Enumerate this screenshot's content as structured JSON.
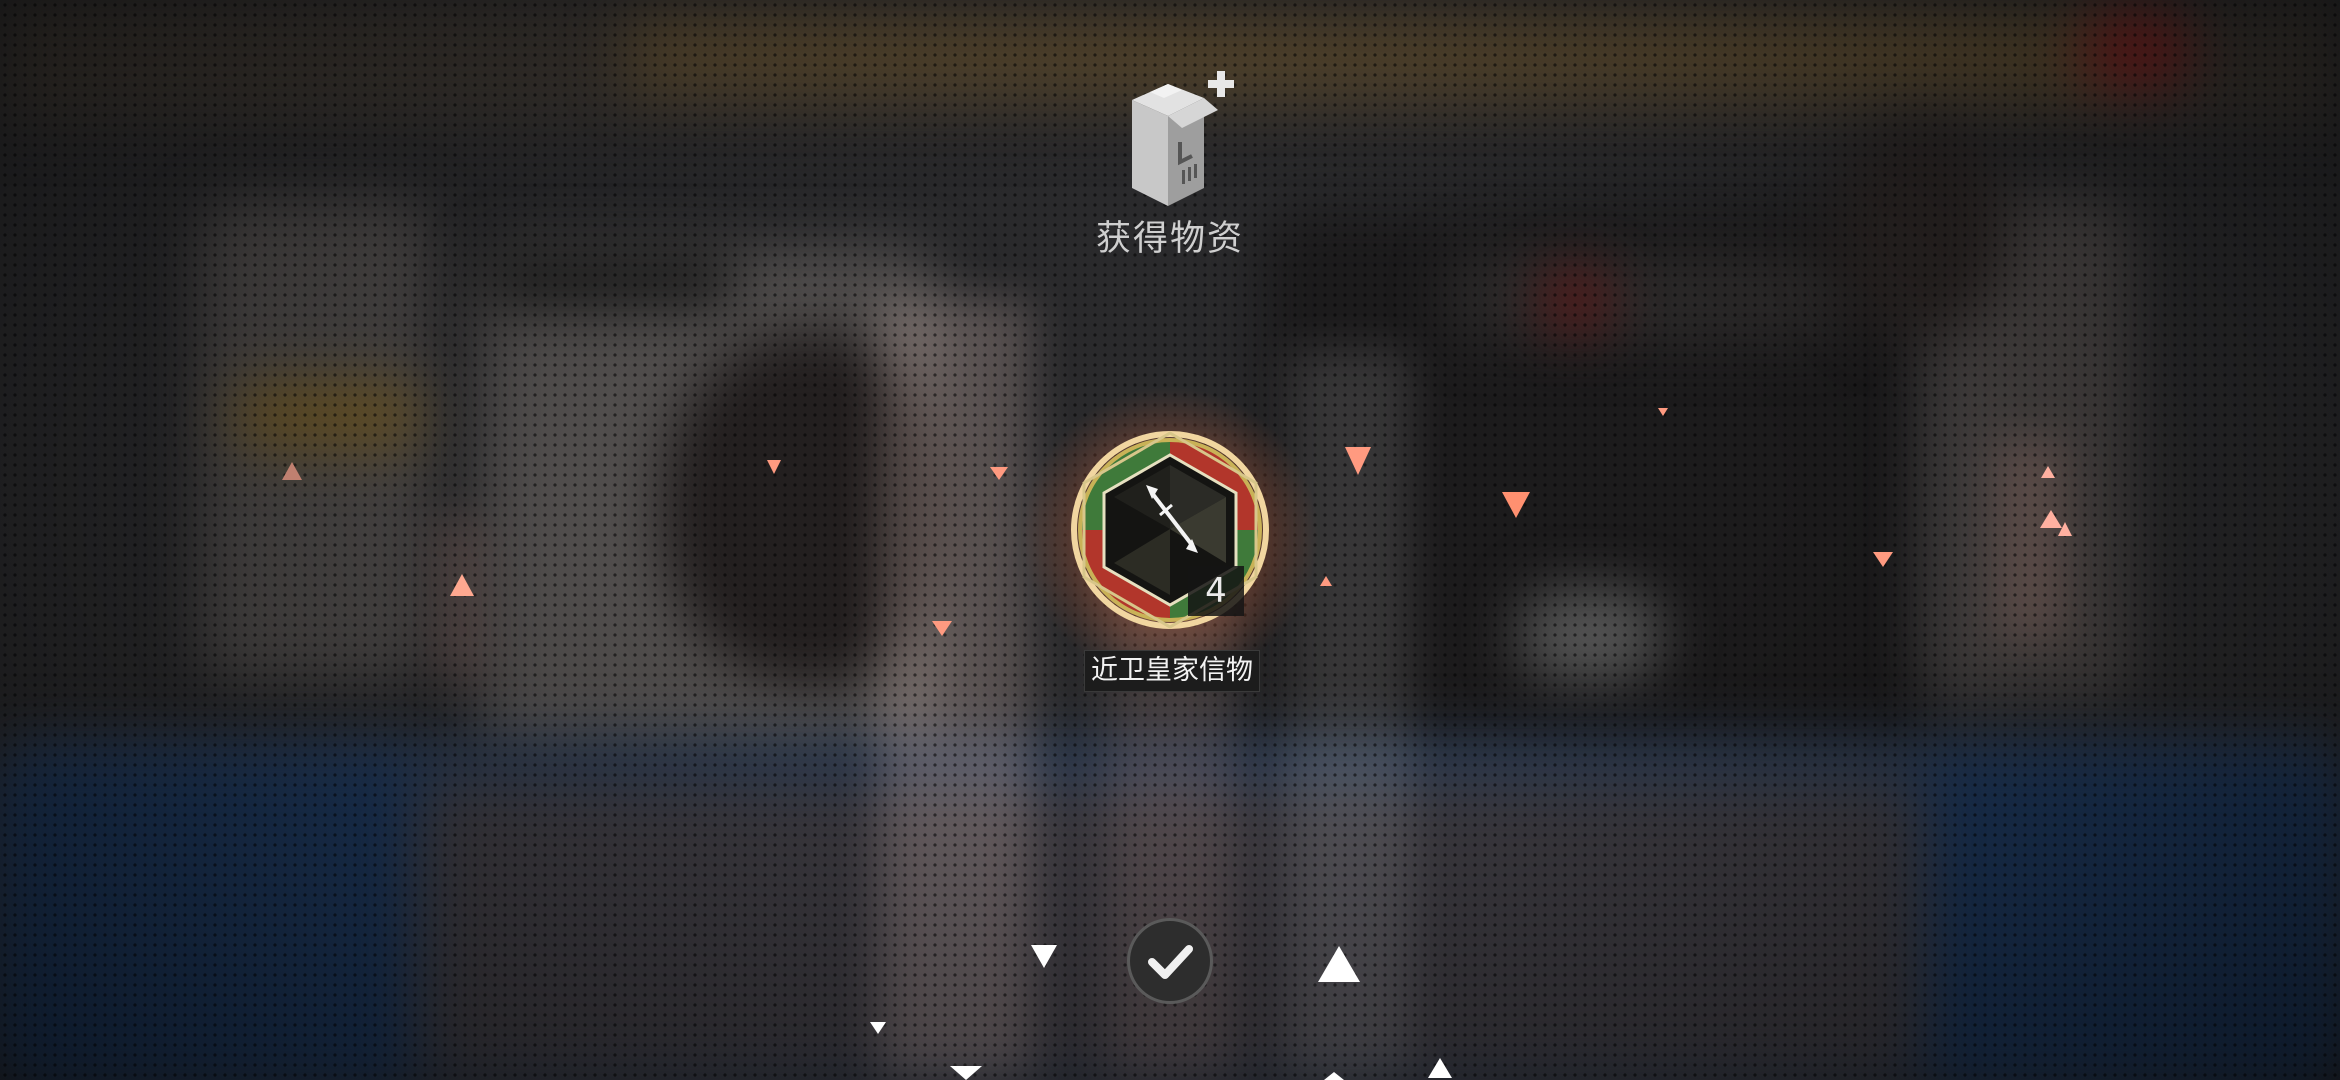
{
  "dialog": {
    "title": "获得物资",
    "header_icon": "supply-box-plus-icon"
  },
  "reward": {
    "icon": "royal-guard-emblem-icon",
    "count": "4",
    "name": "近卫皇家信物"
  },
  "confirm": {
    "icon": "checkmark-icon"
  },
  "colors": {
    "particle": "#ff9a80",
    "particle_light": "#ffffff",
    "glow": "#ffb070",
    "emblem_gold": "#c9b257",
    "emblem_green": "#3f7a3a",
    "emblem_red": "#b2362b"
  }
}
